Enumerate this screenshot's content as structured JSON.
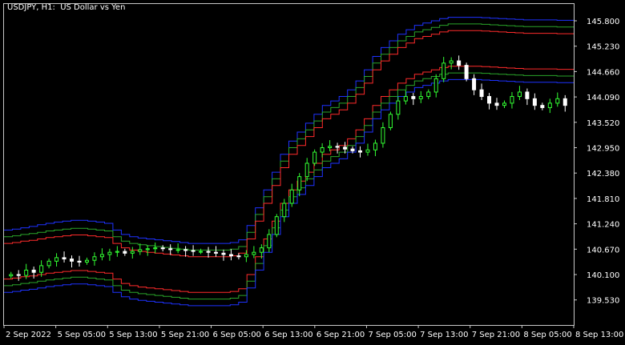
{
  "chart_title": "USDJPY, H1:  US Dollar vs Yen",
  "colors": {
    "background": "#000000",
    "candle_bull": "#33ff33",
    "candle_bear": "#ffffff",
    "band_inner": "#ff2b2b",
    "band_middle": "#2aa52a",
    "band_outer": "#1e32ff",
    "axis_text": "#ffffff",
    "frame": "#c8c8c8"
  },
  "chart_data": {
    "type": "line",
    "title": "USDJPY, H1:  US Dollar vs Yen",
    "x_ticks": [
      "2 Sep 2022",
      "5 Sep 05:00",
      "5 Sep 13:00",
      "5 Sep 21:00",
      "6 Sep 05:00",
      "6 Sep 13:00",
      "6 Sep 21:00",
      "7 Sep 05:00",
      "7 Sep 13:00",
      "7 Sep 21:00",
      "8 Sep 05:00",
      "8 Sep 13:00"
    ],
    "y_ticks": [
      "145.800",
      "145.230",
      "144.660",
      "144.090",
      "143.520",
      "142.950",
      "142.380",
      "141.810",
      "141.240",
      "140.670",
      "140.100",
      "139.530"
    ],
    "ylim": [
      139.3,
      146.1
    ],
    "price": [
      140.1,
      140.08,
      140.2,
      140.15,
      140.3,
      140.4,
      140.48,
      140.45,
      140.4,
      140.38,
      140.42,
      140.5,
      140.55,
      140.6,
      140.62,
      140.58,
      140.62,
      140.66,
      140.68,
      140.7,
      140.68,
      140.66,
      140.66,
      140.64,
      140.62,
      140.62,
      140.6,
      140.58,
      140.55,
      140.52,
      140.5,
      140.55,
      140.6,
      140.7,
      141.0,
      141.4,
      141.7,
      142.0,
      142.3,
      142.6,
      142.85,
      142.95,
      142.98,
      142.96,
      142.92,
      142.88,
      142.85,
      142.9,
      143.05,
      143.4,
      143.7,
      144.0,
      144.1,
      144.05,
      144.1,
      144.2,
      144.5,
      144.85,
      144.9,
      144.8,
      144.5,
      144.25,
      144.1,
      143.95,
      143.9,
      143.95,
      144.1,
      144.2,
      144.05,
      143.9,
      143.85,
      143.95,
      144.05,
      143.9
    ],
    "series": [
      {
        "name": "",
        "role": "upper_outer",
        "values": [
          141.1,
          141.12,
          141.15,
          141.18,
          141.22,
          141.25,
          141.28,
          141.3,
          141.32,
          141.32,
          141.3,
          141.28,
          141.25,
          141.1,
          141.0,
          140.95,
          140.92,
          140.9,
          140.88,
          140.86,
          140.84,
          140.82,
          140.8,
          140.8,
          140.8,
          140.8,
          140.8,
          140.82,
          140.88,
          141.2,
          141.6,
          142.0,
          142.4,
          142.8,
          143.1,
          143.3,
          143.5,
          143.7,
          143.9,
          144.0,
          144.1,
          144.25,
          144.45,
          144.7,
          145.0,
          145.2,
          145.35,
          145.5,
          145.6,
          145.7,
          145.75,
          145.8,
          145.85,
          145.88,
          145.88,
          145.88,
          145.88,
          145.87,
          145.86,
          145.85,
          145.84,
          145.83,
          145.82,
          145.82,
          145.82,
          145.82,
          145.81,
          145.81
        ]
      },
      {
        "name": "",
        "role": "upper_middle",
        "values": [
          140.95,
          140.97,
          141.0,
          141.02,
          141.05,
          141.08,
          141.1,
          141.12,
          141.14,
          141.14,
          141.12,
          141.1,
          141.08,
          140.95,
          140.85,
          140.8,
          140.77,
          140.75,
          140.73,
          140.71,
          140.69,
          140.67,
          140.65,
          140.65,
          140.65,
          140.65,
          140.65,
          140.67,
          140.73,
          141.05,
          141.45,
          141.85,
          142.25,
          142.65,
          142.95,
          143.15,
          143.35,
          143.55,
          143.75,
          143.85,
          143.95,
          144.1,
          144.3,
          144.55,
          144.85,
          145.05,
          145.2,
          145.35,
          145.45,
          145.55,
          145.6,
          145.65,
          145.7,
          145.73,
          145.73,
          145.73,
          145.73,
          145.72,
          145.71,
          145.7,
          145.69,
          145.68,
          145.67,
          145.67,
          145.67,
          145.67,
          145.66,
          145.66
        ]
      },
      {
        "name": "",
        "role": "upper_inner",
        "values": [
          140.8,
          140.82,
          140.85,
          140.87,
          140.9,
          140.93,
          140.95,
          140.97,
          140.99,
          140.99,
          140.97,
          140.95,
          140.93,
          140.8,
          140.7,
          140.65,
          140.62,
          140.6,
          140.58,
          140.56,
          140.54,
          140.52,
          140.5,
          140.5,
          140.5,
          140.5,
          140.5,
          140.52,
          140.58,
          140.9,
          141.3,
          141.7,
          142.1,
          142.5,
          142.8,
          143.0,
          143.2,
          143.4,
          143.6,
          143.7,
          143.8,
          143.95,
          144.15,
          144.4,
          144.7,
          144.9,
          145.05,
          145.2,
          145.3,
          145.4,
          145.45,
          145.5,
          145.55,
          145.58,
          145.58,
          145.58,
          145.58,
          145.57,
          145.56,
          145.55,
          145.54,
          145.53,
          145.52,
          145.52,
          145.52,
          145.52,
          145.51,
          145.51
        ]
      },
      {
        "name": "",
        "role": "lower_inner",
        "values": [
          140.0,
          140.02,
          140.05,
          140.07,
          140.1,
          140.13,
          140.15,
          140.17,
          140.19,
          140.19,
          140.17,
          140.15,
          140.13,
          140.0,
          139.9,
          139.85,
          139.82,
          139.8,
          139.78,
          139.76,
          139.74,
          139.72,
          139.7,
          139.7,
          139.7,
          139.7,
          139.7,
          139.72,
          139.78,
          140.1,
          140.5,
          140.9,
          141.3,
          141.7,
          142.0,
          142.2,
          142.4,
          142.6,
          142.8,
          142.9,
          143.0,
          143.15,
          143.35,
          143.6,
          143.9,
          144.1,
          144.25,
          144.4,
          144.5,
          144.6,
          144.65,
          144.7,
          144.75,
          144.78,
          144.78,
          144.78,
          144.78,
          144.77,
          144.76,
          144.75,
          144.74,
          144.73,
          144.72,
          144.72,
          144.72,
          144.72,
          144.71,
          144.71
        ]
      },
      {
        "name": "",
        "role": "lower_middle",
        "values": [
          139.85,
          139.87,
          139.9,
          139.92,
          139.95,
          139.98,
          140.0,
          140.02,
          140.04,
          140.04,
          140.02,
          140.0,
          139.98,
          139.85,
          139.75,
          139.7,
          139.67,
          139.65,
          139.63,
          139.61,
          139.59,
          139.57,
          139.55,
          139.55,
          139.55,
          139.55,
          139.55,
          139.57,
          139.63,
          139.95,
          140.35,
          140.75,
          141.15,
          141.55,
          141.85,
          142.05,
          142.25,
          142.45,
          142.65,
          142.75,
          142.85,
          143.0,
          143.2,
          143.45,
          143.75,
          143.95,
          144.1,
          144.25,
          144.35,
          144.45,
          144.5,
          144.55,
          144.6,
          144.63,
          144.63,
          144.63,
          144.63,
          144.62,
          144.61,
          144.6,
          144.59,
          144.58,
          144.57,
          144.57,
          144.57,
          144.57,
          144.56,
          144.56
        ]
      },
      {
        "name": "",
        "role": "lower_outer",
        "values": [
          139.7,
          139.72,
          139.75,
          139.77,
          139.8,
          139.83,
          139.85,
          139.87,
          139.89,
          139.89,
          139.87,
          139.85,
          139.83,
          139.7,
          139.6,
          139.55,
          139.52,
          139.5,
          139.48,
          139.46,
          139.44,
          139.42,
          139.4,
          139.4,
          139.4,
          139.4,
          139.4,
          139.42,
          139.48,
          139.8,
          140.2,
          140.6,
          141.0,
          141.4,
          141.7,
          141.9,
          142.1,
          142.3,
          142.5,
          142.6,
          142.7,
          142.85,
          143.05,
          143.3,
          143.6,
          143.8,
          143.95,
          144.1,
          144.2,
          144.3,
          144.35,
          144.4,
          144.45,
          144.48,
          144.48,
          144.48,
          144.48,
          144.47,
          144.46,
          144.45,
          144.44,
          144.43,
          144.42,
          144.42,
          144.42,
          144.42,
          144.41,
          144.41
        ]
      }
    ],
    "grid": false,
    "legend": "none"
  }
}
